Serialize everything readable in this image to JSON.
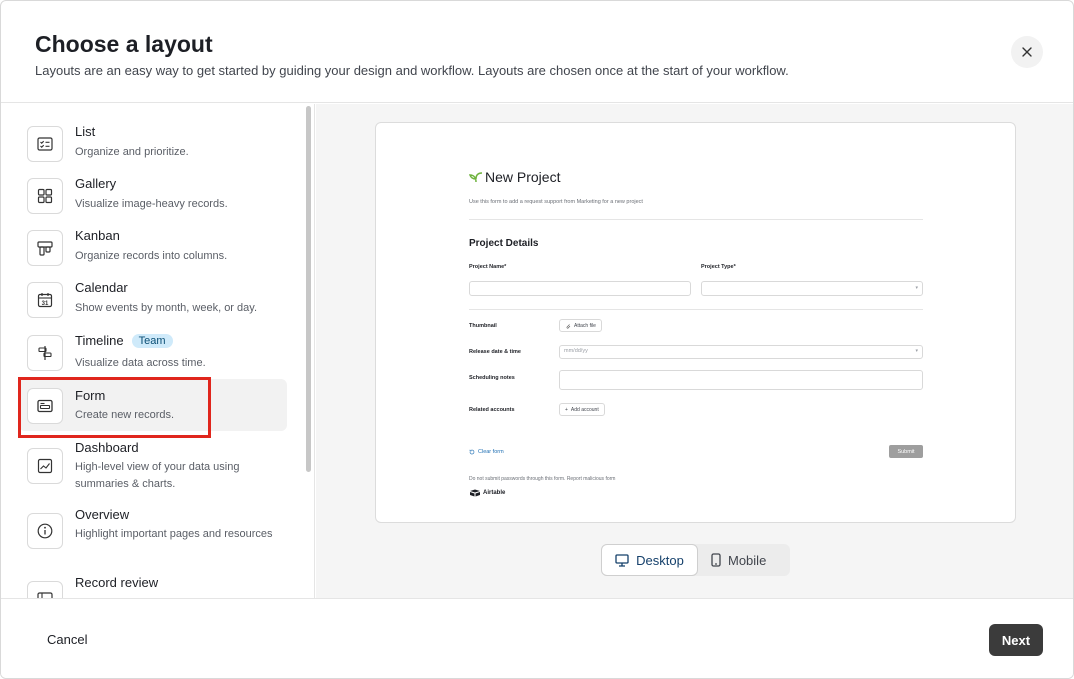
{
  "header": {
    "title": "Choose a layout",
    "subtitle": "Layouts are an easy way to get started by guiding your design and workflow. Layouts are chosen once at the start of your workflow."
  },
  "sidebar": {
    "items": [
      {
        "label": "List",
        "desc": "Organize and prioritize.",
        "icon": "checklist-icon"
      },
      {
        "label": "Gallery",
        "desc": "Visualize image-heavy records.",
        "icon": "grid-icon"
      },
      {
        "label": "Kanban",
        "desc": "Organize records into columns.",
        "icon": "kanban-icon"
      },
      {
        "label": "Calendar",
        "desc": "Show events by month, week, or day.",
        "icon": "calendar-icon",
        "calendar_day": "31"
      },
      {
        "label": "Timeline",
        "desc": "Visualize data across time.",
        "icon": "timeline-icon",
        "badge": "Team"
      },
      {
        "label": "Form",
        "desc": "Create new records.",
        "icon": "form-icon",
        "selected": true
      },
      {
        "label": "Dashboard",
        "desc": "High-level view of your data using summaries & charts.",
        "icon": "chart-icon"
      },
      {
        "label": "Overview",
        "desc": "Highlight important pages and resources",
        "icon": "info-icon"
      },
      {
        "label": "Record review",
        "desc": "",
        "icon": "record-review-icon"
      }
    ]
  },
  "preview": {
    "form_title": "New Project",
    "form_desc": "Use this form to add a request support from Marketing for a new project",
    "section": "Project Details",
    "project_name_label": "Project Name*",
    "project_type_label": "Project Type*",
    "thumbnail_label": "Thumbnail",
    "attach_label": "Attach file",
    "release_label": "Release date & time",
    "date_placeholder": "mm/dd/yy",
    "notes_label": "Scheduling notes",
    "accounts_label": "Related accounts",
    "add_account_label": "Add account",
    "clear_label": "Clear form",
    "submit_label": "Submit",
    "warning": "Do not submit passwords through this form. Report malicious form",
    "brand": "Airtable",
    "accent_color": "#6fb33e"
  },
  "view_toggle": {
    "desktop": "Desktop",
    "mobile": "Mobile",
    "active": "desktop"
  },
  "footer": {
    "cancel": "Cancel",
    "next": "Next"
  },
  "colors": {
    "selection_highlight": "#e0261d",
    "team_badge_bg": "#cfeafa",
    "next_button_bg": "#3b3b3b"
  }
}
